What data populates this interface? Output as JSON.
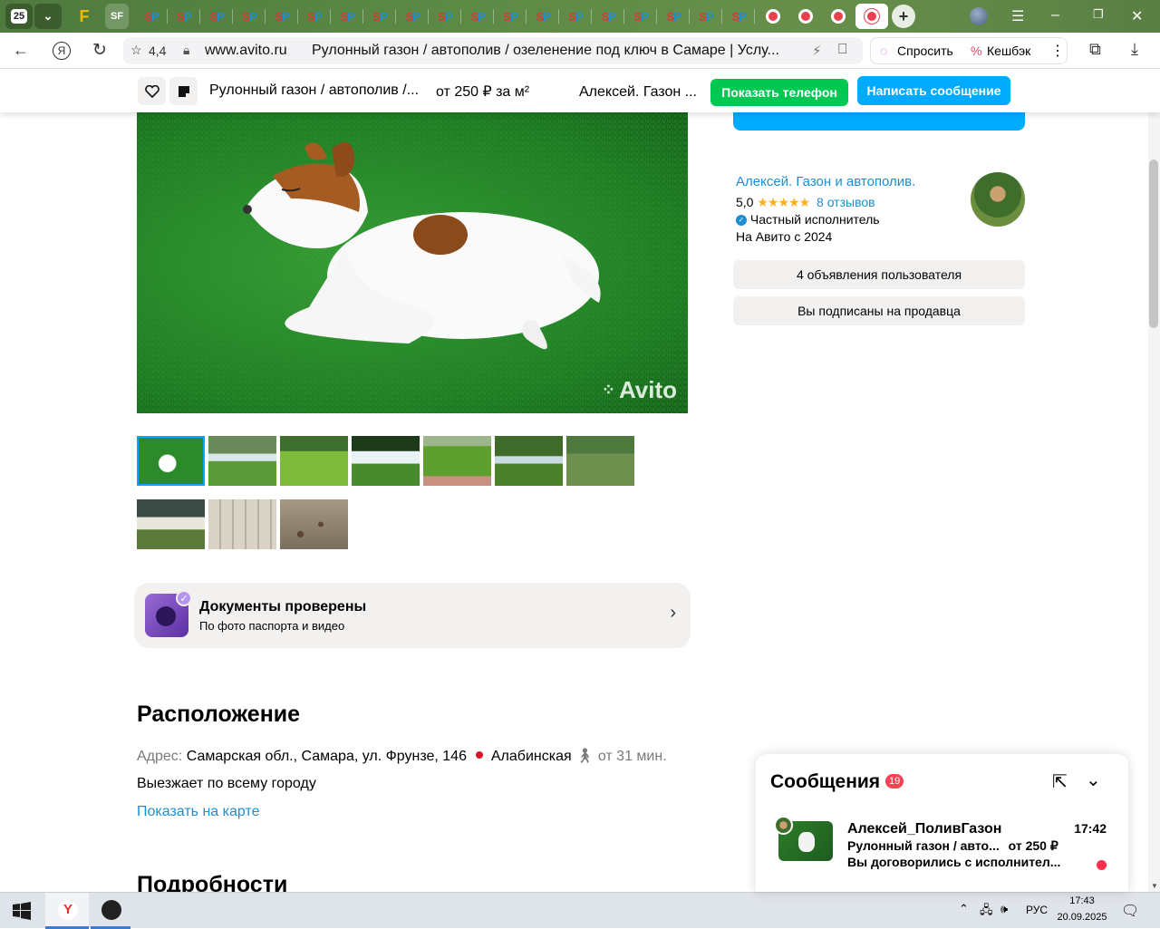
{
  "browser": {
    "tab_count": "25",
    "pinned_f": "F",
    "pinned_sf": "SF",
    "sp_label_s": "S",
    "sp_label_p": "P",
    "rating": "4,4",
    "domain": "www.avito.ru",
    "page_title": "Рулонный газон / автополив / озеленение под ключ в Самаре | Услу...",
    "ask_label": "Спросить",
    "cashback_label": "Кешбэк"
  },
  "sticky": {
    "title": "Рулонный газон / автополив /...",
    "price": "от 250 ₽ за м²",
    "seller": "Алексей. Газон ...",
    "show_phone": "Показать телефон",
    "write_message": "Написать сообщение"
  },
  "seller": {
    "name": "Алексей. Газон и автополив.",
    "rating": "5,0",
    "stars": "★★★★★",
    "reviews": "8 отзывов",
    "type": "Частный исполнитель",
    "since": "На Авито с 2024",
    "listings_button": "4 объявления пользователя",
    "subscribed_button": "Вы подписаны на продавца"
  },
  "photo": {
    "watermark": "Avito"
  },
  "documents": {
    "title": "Документы проверены",
    "subtitle": "По фото паспорта и видео"
  },
  "location": {
    "heading": "Расположение",
    "address_label": "Адрес:",
    "address": "Самарская обл., Самара, ул. Фрунзе, 146",
    "metro": "Алабинская",
    "walk_time": "от 31 мин.",
    "travel": "Выезжает по всему городу",
    "map_link": "Показать на карте",
    "metro_color": "#e0112b"
  },
  "details": {
    "heading": "Подробности"
  },
  "messages": {
    "title": "Сообщения",
    "count": "19",
    "chat": {
      "name": "Алексей_ПоливГазон",
      "time": "17:42",
      "listing": "Рулонный газон / авто...",
      "price": "от 250 ₽",
      "preview": "Вы договорились с исполнител..."
    }
  },
  "taskbar": {
    "lang": "РУС",
    "time": "17:43",
    "date": "20.09.2025"
  },
  "colors": {
    "accent_blue": "#00aaff",
    "green": "#00c853",
    "link": "#1a8fd4"
  }
}
